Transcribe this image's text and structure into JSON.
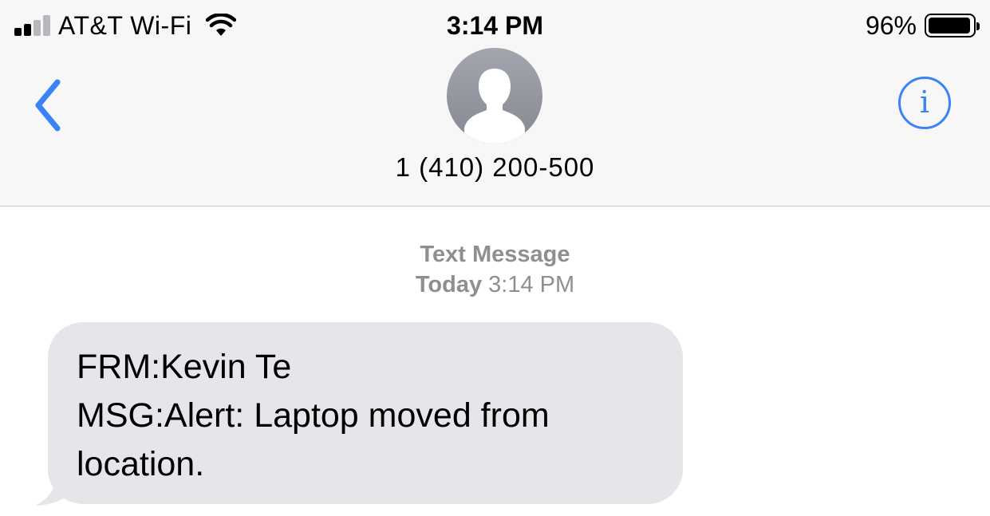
{
  "status_bar": {
    "carrier": "AT&T Wi-Fi",
    "time": "3:14 PM",
    "battery_percent": "96%",
    "signal_bars_active": 2,
    "signal_bars_total": 4,
    "battery_level": 0.96
  },
  "nav": {
    "back_icon": "chevron-left-icon",
    "info_icon": "info-icon",
    "info_glyph": "i",
    "contact_name": "1 (410) 200-500",
    "avatar_icon": "person-silhouette-icon"
  },
  "conversation": {
    "service": "Text Message",
    "day": "Today",
    "time": "3:14 PM",
    "messages": [
      {
        "direction": "incoming",
        "lines": [
          "FRM:Kevin Te",
          "MSG:Alert: Laptop moved from",
          "location."
        ]
      }
    ]
  },
  "colors": {
    "accent": "#3a82f7",
    "incoming_bubble": "#e5e5ea",
    "timestamp_text": "#8e8e93",
    "header_bg": "#f7f7f7"
  }
}
